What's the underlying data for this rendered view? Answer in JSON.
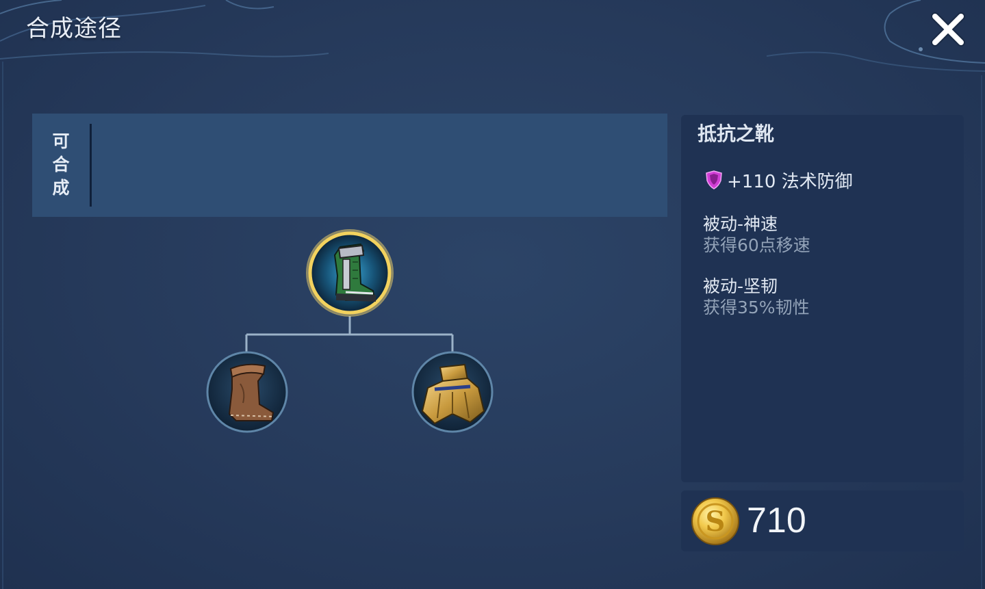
{
  "window": {
    "title": "合成途径",
    "close_icon": "close-icon"
  },
  "craftable": {
    "label_chars": [
      "可",
      "合",
      "成"
    ]
  },
  "recipe": {
    "target_icon": "green-armored-boots-icon",
    "components": [
      {
        "icon": "leather-boots-icon"
      },
      {
        "icon": "golden-cloak-armor-icon"
      }
    ]
  },
  "item": {
    "name": "抵抗之靴",
    "stat_icon": "magic-defense-shield-icon",
    "stat_text": "+110 法术防御",
    "passives": [
      {
        "name": "被动-神速",
        "desc": "获得60点移速"
      },
      {
        "name": "被动-坚韧",
        "desc": "获得35%韧性"
      }
    ]
  },
  "price": {
    "coin_icon": "gold-coin-icon",
    "value": "710"
  },
  "colors": {
    "background": "#25395a",
    "panel": "#1f3253",
    "craftable_panel": "#2f4e74",
    "gold": "#f2c94c",
    "magic_defense": "#d13fd6"
  }
}
